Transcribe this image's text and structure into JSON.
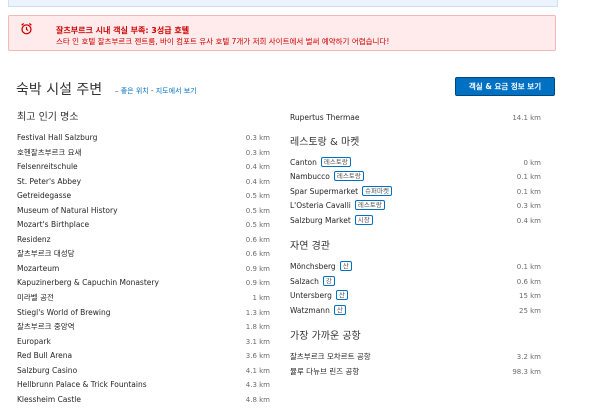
{
  "alert": {
    "title": "잘츠부르크 시내 객실 부족: 3성급 호텔",
    "message": "스타 인 호텔 잘츠부르크 젠트룸, 바이 컴포트 유사 호텔 7개가 저희 사이트에서 벌써 예약하기 어렵습니다!",
    "color": "#cc0000"
  },
  "section": {
    "title": "숙박 시설 주변",
    "prefix": "–",
    "link1": "좋은 위치",
    "sep": "-",
    "link2": "지도에서 보기",
    "cta": "객실 & 요금 정보 보기"
  },
  "popular": {
    "heading": "최고 인기 명소",
    "items": [
      {
        "name": "Festival Hall Salzburg",
        "dist": "0.3 km"
      },
      {
        "name": "호헨잘츠부르크 요새",
        "dist": "0.3 km"
      },
      {
        "name": "Felsenreitschule",
        "dist": "0.4 km"
      },
      {
        "name": "St. Peter's Abbey",
        "dist": "0.4 km"
      },
      {
        "name": "Getreidegasse",
        "dist": "0.5 km"
      },
      {
        "name": "Museum of Natural History",
        "dist": "0.5 km"
      },
      {
        "name": "Mozart's Birthplace",
        "dist": "0.5 km"
      },
      {
        "name": "Residenz",
        "dist": "0.6 km"
      },
      {
        "name": "잘츠부르크 대성당",
        "dist": "0.6 km"
      },
      {
        "name": "Mozarteum",
        "dist": "0.9 km"
      },
      {
        "name": "Kapuzinerberg & Capuchin Monastery",
        "dist": "0.9 km"
      },
      {
        "name": "미라벨 공전",
        "dist": "1 km"
      },
      {
        "name": "Stiegl's World of Brewing",
        "dist": "1.3 km"
      },
      {
        "name": "잘츠부르크 중앙역",
        "dist": "1.8 km"
      },
      {
        "name": "Europark",
        "dist": "3.1 km"
      },
      {
        "name": "Red Bull Arena",
        "dist": "3.6 km"
      },
      {
        "name": "Salzburg Casino",
        "dist": "4.1 km"
      },
      {
        "name": "Hellbrunn Palace & Trick Fountains",
        "dist": "4.3 km"
      },
      {
        "name": "Klessheim Castle",
        "dist": "4.8 km"
      }
    ]
  },
  "top_right": {
    "name": "Rupertus Thermae",
    "dist": "14.1 km"
  },
  "restaurants": {
    "heading": "레스토랑 & 마켓",
    "items": [
      {
        "name": "Canton",
        "tag": "레스토랑",
        "dist": "0 km"
      },
      {
        "name": "Nambucco",
        "tag": "레스토랑",
        "dist": "0.1 km"
      },
      {
        "name": "Spar Supermarket",
        "tag": "슈퍼마켓",
        "dist": "0.1 km"
      },
      {
        "name": "L'Osteria Cavalli",
        "tag": "레스토랑",
        "dist": "0.3 km"
      },
      {
        "name": "Salzburg Market",
        "tag": "시장",
        "dist": "0.4 km"
      }
    ]
  },
  "nature": {
    "heading": "자연 경관",
    "items": [
      {
        "name": "Mönchsberg",
        "tag": "산",
        "dist": "0.1 km"
      },
      {
        "name": "Salzach",
        "tag": "강",
        "dist": "0.6 km"
      },
      {
        "name": "Untersberg",
        "tag": "산",
        "dist": "15 km"
      },
      {
        "name": "Watzmann",
        "tag": "산",
        "dist": "25 km"
      }
    ]
  },
  "airports": {
    "heading": "가장 가까운 공항",
    "items": [
      {
        "name": "잘츠부르크 모차르트 공항",
        "dist": "3.2 km"
      },
      {
        "name": "뮬루 다뉴브 린즈 공항",
        "dist": "98.3 km"
      }
    ]
  },
  "icons": {
    "alert": "alarm-clock-icon"
  },
  "colors": {
    "link": "#0071c2",
    "cta_bg": "#0071c2",
    "alert_bg": "#ffebeb"
  }
}
